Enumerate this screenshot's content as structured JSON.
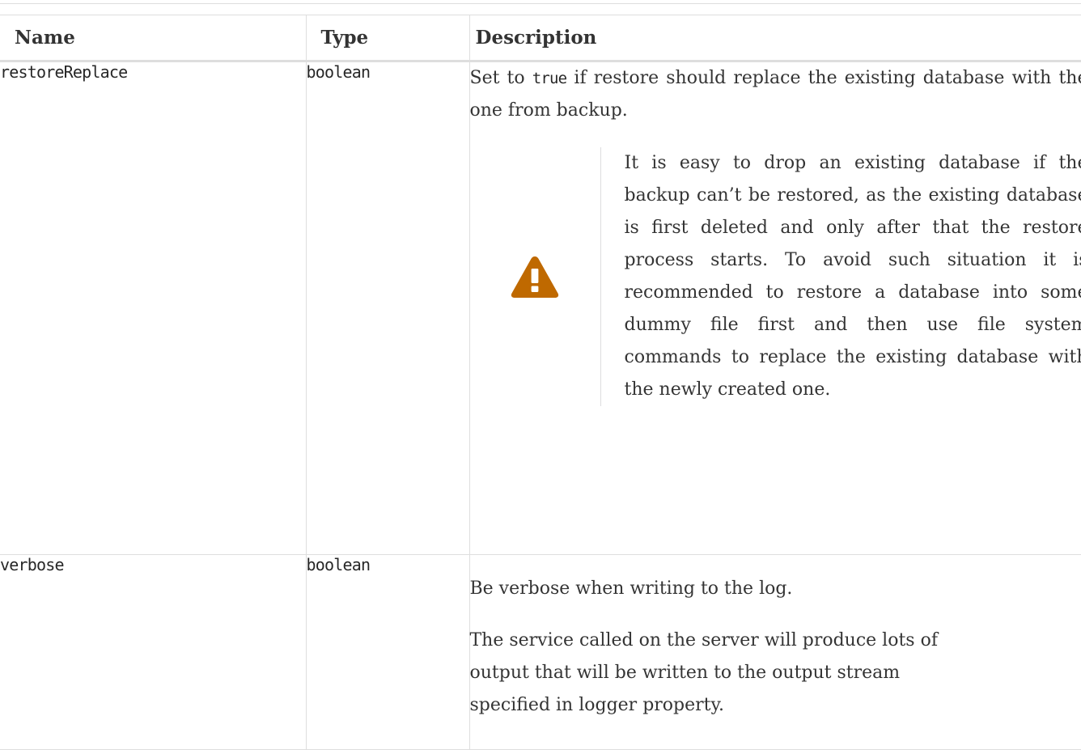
{
  "table": {
    "headers": {
      "name": "Name",
      "type": "Type",
      "description": "Description"
    },
    "rows": [
      {
        "name": "restoreReplace",
        "type": "boolean",
        "desc_before_code": "Set to ",
        "desc_code": "true",
        "desc_after_code": " if restore should replace the existing database with the one from backup.",
        "warning": {
          "icon": "warning-triangle-icon",
          "icon_color": "#bf6900",
          "text": "It is easy to drop an existing database if the backup can’t be restored, as the existing database is first deleted and only after that the restore process starts. To avoid such situation it is recommended to restore a database into some dummy file first and then use file system commands to replace the existing database with the newly created one."
        }
      },
      {
        "name": "verbose",
        "type": "boolean",
        "desc_line1": "Be verbose when writing to the log.",
        "desc_line2": "The service called on the server will produce lots of output that will be written to the output stream specified in logger property."
      }
    ]
  }
}
